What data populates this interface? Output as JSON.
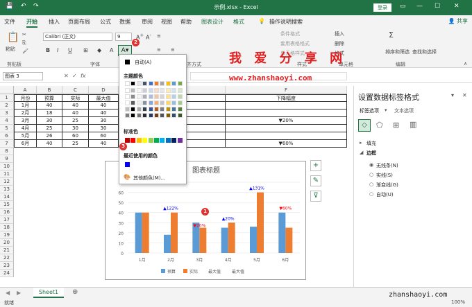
{
  "titlebar": {
    "filename": "示例.xlsx  -  Excel",
    "login": "登录"
  },
  "tabs": [
    "文件",
    "开始",
    "插入",
    "页面布局",
    "公式",
    "数据",
    "审阅",
    "视图",
    "帮助",
    "图表设计",
    "格式"
  ],
  "tell_me": "操作说明搜索",
  "share": "共享",
  "ribbon": {
    "paste": "粘贴",
    "clipboard": "剪贴板",
    "font_name": "Calibri (正文)",
    "font_size": "9",
    "font_group": "字体",
    "align_group": "对齐方式",
    "cond_format": "条件格式",
    "table_format": "套用表格格式",
    "cell_style": "单元格样式",
    "style_group": "样式",
    "cells_group": "单元格",
    "cells_btn": "单元格",
    "insert": "插入",
    "delete": "删除",
    "format": "格式",
    "sum": "Σ",
    "sort": "排序和筛选",
    "find": "查找和选择",
    "edit_group": "编辑"
  },
  "namebox": "图表 3",
  "columns": [
    "A",
    "B",
    "C",
    "D",
    "E",
    "F"
  ],
  "rows": [
    "1",
    "2",
    "3",
    "4",
    "5",
    "6",
    "7",
    "8",
    "9",
    "10",
    "11",
    "12",
    "13",
    "14",
    "15",
    "16",
    "17",
    "18",
    "19",
    "20",
    "21",
    "22",
    "23",
    "24"
  ],
  "table": {
    "header": [
      "月份",
      "预算",
      "实际",
      "最大值",
      "",
      "下降幅度"
    ],
    "data": [
      [
        "1月",
        "40",
        "40",
        "40",
        "",
        ""
      ],
      [
        "2月",
        "18",
        "40",
        "40",
        "",
        ""
      ],
      [
        "3月",
        "30",
        "25",
        "30",
        "",
        "▼20%"
      ],
      [
        "4月",
        "25",
        "30",
        "30",
        "",
        ""
      ],
      [
        "5月",
        "26",
        "60",
        "60",
        "",
        ""
      ],
      [
        "6月",
        "40",
        "25",
        "40",
        "",
        "▼60%"
      ]
    ]
  },
  "color_popup": {
    "auto": "自动(A)",
    "theme": "主题颜色",
    "standard": "标准色",
    "recent": "最近使用的颜色",
    "more": "其他颜色(M)...",
    "theme_top": [
      "#ffffff",
      "#000000",
      "#e7e6e6",
      "#44546a",
      "#4472c4",
      "#ed7d31",
      "#a5a5a5",
      "#ffc000",
      "#5b9bd5",
      "#70ad47"
    ],
    "standard_colors": [
      "#c00000",
      "#ff0000",
      "#ffc000",
      "#ffff00",
      "#92d050",
      "#00b050",
      "#00b0f0",
      "#0070c0",
      "#002060",
      "#7030a0"
    ],
    "recent_colors": [
      "#0000ff"
    ]
  },
  "chart_data": {
    "type": "bar",
    "title": "图表标题",
    "categories": [
      "1月",
      "2月",
      "3月",
      "4月",
      "5月",
      "6月"
    ],
    "series": [
      {
        "name": "预算",
        "values": [
          40,
          18,
          30,
          25,
          26,
          40
        ],
        "color": "#5b9bd5"
      },
      {
        "name": "实际",
        "values": [
          40,
          40,
          25,
          30,
          60,
          25
        ],
        "color": "#ed7d31"
      }
    ],
    "extra_legend": [
      "最大值",
      "最大值"
    ],
    "ylim": [
      0,
      70
    ],
    "yticks": [
      "0",
      "10",
      "20",
      "30",
      "40",
      "50",
      "60",
      "70"
    ],
    "data_labels": [
      "▲122%",
      "▼20%",
      "▲20%",
      "▲131%",
      "▼60%"
    ],
    "label_colors": [
      "#0000ff",
      "#ff0000",
      "#0000ff",
      "#0000ff",
      "#ff0000"
    ]
  },
  "pane": {
    "title": "设置数据标签格式",
    "tab1": "标签选项",
    "tab2": "文本选项",
    "fill": "填充",
    "border": "边框",
    "opt1": "无线条(N)",
    "opt2": "实线(S)",
    "opt3": "渐变线(G)",
    "opt4": "自动(U)"
  },
  "sheet": "Sheet1",
  "status": {
    "mode": "就绪",
    "zoom": "100%"
  },
  "watermark": {
    "main": "我 爱 分 享 网",
    "url": "www.zhanshaoyi.com",
    "bottom": "zhanshaoyi.com"
  },
  "markers": {
    "one": "1",
    "two": "2",
    "three": "3"
  }
}
